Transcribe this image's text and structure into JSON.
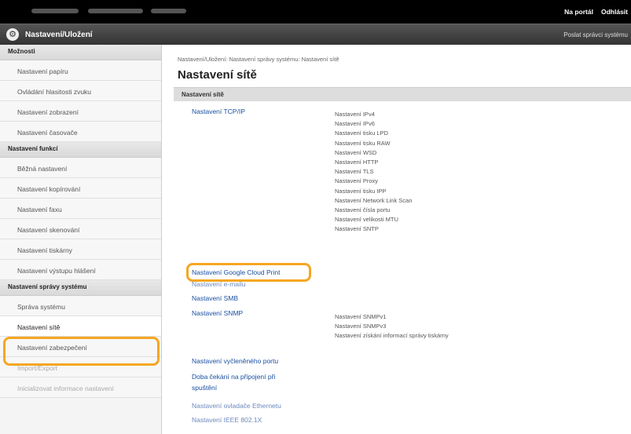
{
  "topbar": {
    "portal_link": "Na portál",
    "logout_link": "Odhlásit"
  },
  "header": {
    "title": "Nastavení/Uložení",
    "admin_link": "Poslat správci systému"
  },
  "sidebar": {
    "groups": [
      {
        "heading": "Možnosti",
        "items": [
          "Nastavení papíru",
          "Ovládání hlasitosti zvuku",
          "Nastavení zobrazení",
          "Nastavení časovače"
        ]
      },
      {
        "heading": "Nastavení funkcí",
        "items": [
          "Běžná nastavení",
          "Nastavení kopírování",
          "Nastavení faxu",
          "Nastavení skenování",
          "Nastavení tiskárny",
          "Nastavení výstupu hlášení"
        ]
      },
      {
        "heading": "Nastavení správy systému",
        "items": [
          "Správa systému",
          "Nastavení sítě",
          "Nastavení zabezpečení",
          "Import/Export",
          "Inicializovat informace nastavení"
        ]
      }
    ]
  },
  "main": {
    "breadcrumb": "Nastavení/Uložení: Nastavení správy systému: Nastavení sítě",
    "title": "Nastavení sítě",
    "section_label": "Nastavení sítě",
    "links": [
      "Nastavení TCP/IP",
      "Nastavení Google Cloud Print",
      "Nastavení e-mailu",
      "Nastavení SMB",
      "Nastavení SNMP",
      "Nastavení vyčleněného portu",
      "Doba čekání na připojení při spuštění",
      "Nastavení ovladače Ethernetu",
      "Nastavení IEEE 802.1X"
    ],
    "tcpip_items": [
      "Nastavení IPv4",
      "Nastavení IPv6",
      "Nastavení tisku LPD",
      "Nastavení tisku RAW",
      "Nastavení WSD",
      "Nastavení HTTP",
      "Nastavení TLS",
      "Nastavení Proxy",
      "Nastavení tisku IPP",
      "Nastavení Network Link Scan",
      "Nastavení čísla portu",
      "Nastavení velikosti MTU",
      "Nastavení SNTP"
    ],
    "snmp_items": [
      "Nastavení SNMPv1",
      "Nastavení SNMPv3",
      "Nastavení získání informací správy tiskárny"
    ]
  },
  "colors": {
    "highlight": "#f5a623",
    "link": "#1a4fa0"
  }
}
